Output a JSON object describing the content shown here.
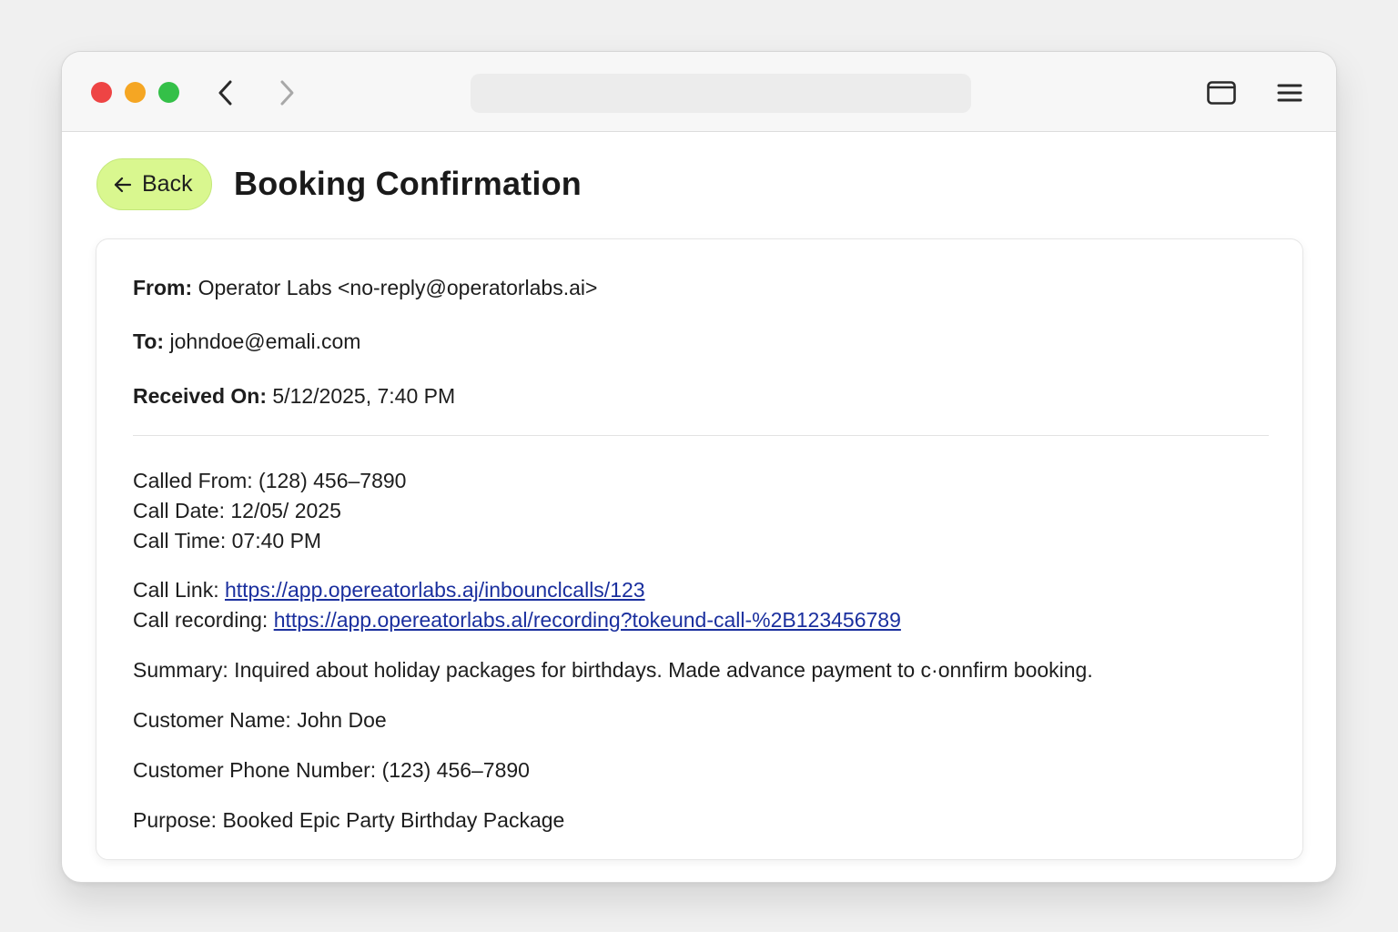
{
  "browser": {
    "traffic_lights": {
      "close": "#ee4444",
      "minimize": "#f5a623",
      "maximize": "#34c048"
    },
    "icons": {
      "back": "chevron-left-icon",
      "forward": "chevron-right-icon",
      "tabs": "tab-overview-icon",
      "menu": "hamburger-menu-icon"
    }
  },
  "header": {
    "back_label": "Back",
    "back_color": "#d9f78f",
    "title": "Booking Confirmation"
  },
  "email": {
    "from_label": "From:",
    "from_value": "Operator Labs <no-reply@operatorlabs.ai>",
    "to_label": "To:",
    "to_value": "johndoe@emali.com",
    "received_label": "Received On:",
    "received_value": "5/12/2025, 7:40 PM",
    "called_from": "Called From: (128) 456–7890",
    "call_date": "Call Date: 12/05/ 2025",
    "call_time": "Call Time: 07:40 PM",
    "call_link_label": "Call Link: ",
    "call_link_url": "https://app.opereatorlabs.aj/inbounclcalls/123",
    "call_recording_label": "Call recording: ",
    "call_recording_url": "https://app.opereatorlabs.al/recording?tokeund-call-%2B123456789",
    "summary": "Summary: Inquired about holiday packages for birthdays. Made advance payment to c·onnfirm booking.",
    "customer_name": "Customer Name: John Doe",
    "customer_phone": "Customer Phone Number: (123) 456–7890",
    "purpose": "Purpose: Booked Epic Party Birthday Package"
  }
}
